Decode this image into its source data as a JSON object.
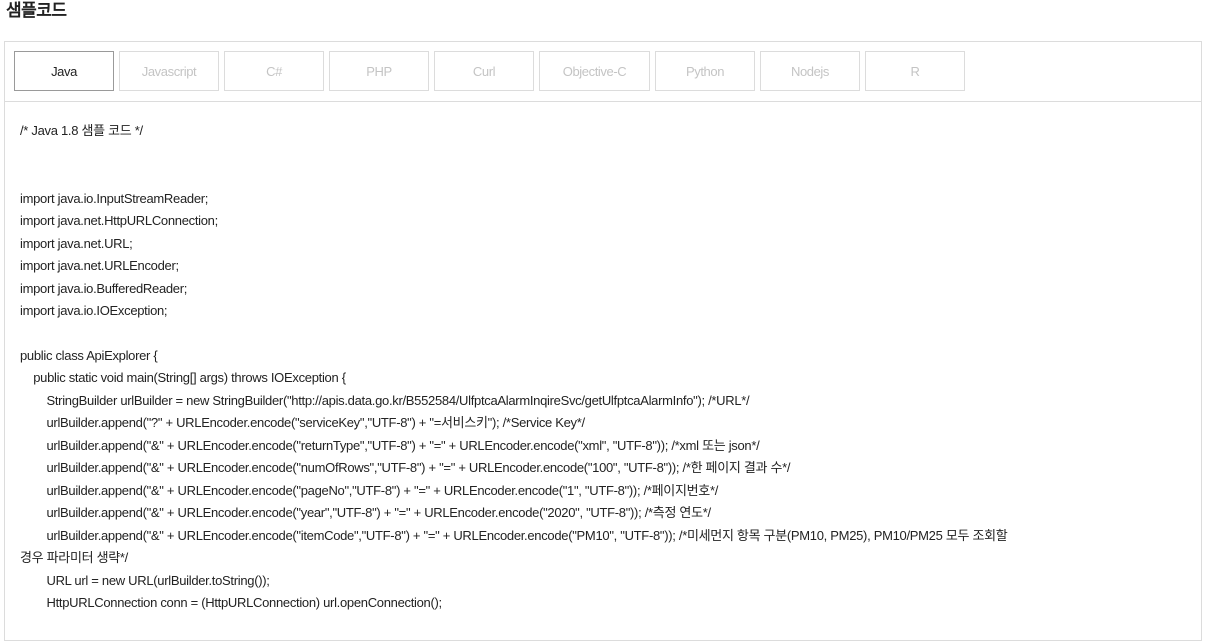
{
  "section": {
    "title": "샘플코드"
  },
  "tabs": [
    {
      "label": "Java",
      "active": true
    },
    {
      "label": "Javascript",
      "active": false
    },
    {
      "label": "C#",
      "active": false
    },
    {
      "label": "PHP",
      "active": false
    },
    {
      "label": "Curl",
      "active": false
    },
    {
      "label": "Objective-C",
      "active": false
    },
    {
      "label": "Python",
      "active": false
    },
    {
      "label": "Nodejs",
      "active": false
    },
    {
      "label": "R",
      "active": false
    }
  ],
  "code": {
    "header_comment": "/* Java 1.8 샘플 코드 */",
    "imports": [
      "import java.io.InputStreamReader;",
      "import java.net.HttpURLConnection;",
      "import java.net.URL;",
      "import java.net.URLEncoder;",
      "import java.io.BufferedReader;",
      "import java.io.IOException;"
    ],
    "body": [
      "public class ApiExplorer {",
      "    public static void main(String[] args) throws IOException {",
      "        StringBuilder urlBuilder = new StringBuilder(\"http://apis.data.go.kr/B552584/UlfptcaAlarmInqireSvc/getUlfptcaAlarmInfo\"); /*URL*/",
      "        urlBuilder.append(\"?\" + URLEncoder.encode(\"serviceKey\",\"UTF-8\") + \"=서비스키\"); /*Service Key*/",
      "        urlBuilder.append(\"&\" + URLEncoder.encode(\"returnType\",\"UTF-8\") + \"=\" + URLEncoder.encode(\"xml\", \"UTF-8\")); /*xml 또는 json*/",
      "        urlBuilder.append(\"&\" + URLEncoder.encode(\"numOfRows\",\"UTF-8\") + \"=\" + URLEncoder.encode(\"100\", \"UTF-8\")); /*한 페이지 결과 수*/",
      "        urlBuilder.append(\"&\" + URLEncoder.encode(\"pageNo\",\"UTF-8\") + \"=\" + URLEncoder.encode(\"1\", \"UTF-8\")); /*페이지번호*/",
      "        urlBuilder.append(\"&\" + URLEncoder.encode(\"year\",\"UTF-8\") + \"=\" + URLEncoder.encode(\"2020\", \"UTF-8\")); /*측정 연도*/",
      "        urlBuilder.append(\"&\" + URLEncoder.encode(\"itemCode\",\"UTF-8\") + \"=\" + URLEncoder.encode(\"PM10\", \"UTF-8\")); /*미세먼지 항목 구분(PM10, PM25), PM10/PM25 모두 조회할",
      "경우 파라미터 생략*/",
      "        URL url = new URL(urlBuilder.toString());",
      "        HttpURLConnection conn = (HttpURLConnection) url.openConnection();"
    ]
  }
}
